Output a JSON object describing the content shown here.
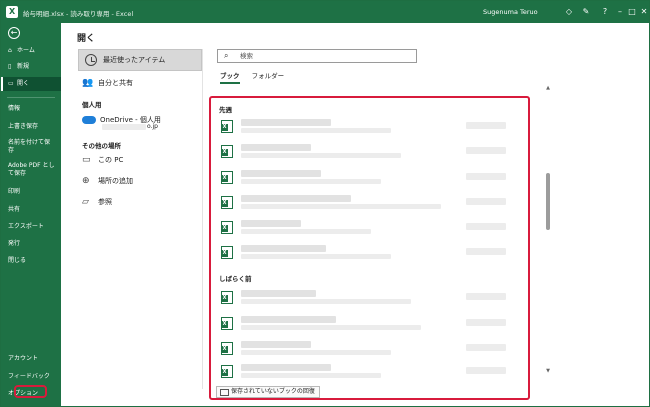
{
  "titlebar": {
    "document": "給与明細.xlsx  -  読み取り専用  -  Excel",
    "user": "Sugenuma Teruo",
    "icons": [
      "diamond-icon",
      "pen-icon",
      "help-icon",
      "minimize-icon",
      "maximize-icon",
      "close-icon"
    ]
  },
  "nav": {
    "items": [
      {
        "label": "ホーム",
        "icon": "home-icon"
      },
      {
        "label": "新規",
        "icon": "new-icon"
      },
      {
        "label": "開く",
        "icon": "folder-icon"
      },
      {
        "label": "情報"
      },
      {
        "label": "上書き保存"
      },
      {
        "label": "名前を付けて保存"
      },
      {
        "label": "Adobe PDF として保存"
      },
      {
        "label": "印刷"
      },
      {
        "label": "共有"
      },
      {
        "label": "エクスポート"
      },
      {
        "label": "発行"
      },
      {
        "label": "閉じる"
      }
    ],
    "bottom": [
      {
        "label": "アカウント"
      },
      {
        "label": "フィードバック"
      },
      {
        "label": "オプション"
      }
    ]
  },
  "open": {
    "title": "開く",
    "recent": "最近使ったアイテム",
    "shared": "自分と共有",
    "personal_header": "個人用",
    "onedrive": "OneDrive - 個人用",
    "onedrive_email_suffix": "o.jp",
    "other_header": "その他の場所",
    "this_pc": "この PC",
    "add_place": "場所の追加",
    "browse": "参照"
  },
  "search": {
    "placeholder": "検索"
  },
  "tabs": {
    "book": "ブック",
    "folder": "フォルダー"
  },
  "groups": {
    "earlier": "先週",
    "older": "しばらく前"
  },
  "recover_button": "保存されていないブックの回復",
  "accent": "#1e7145",
  "highlight": "#d81b3c"
}
